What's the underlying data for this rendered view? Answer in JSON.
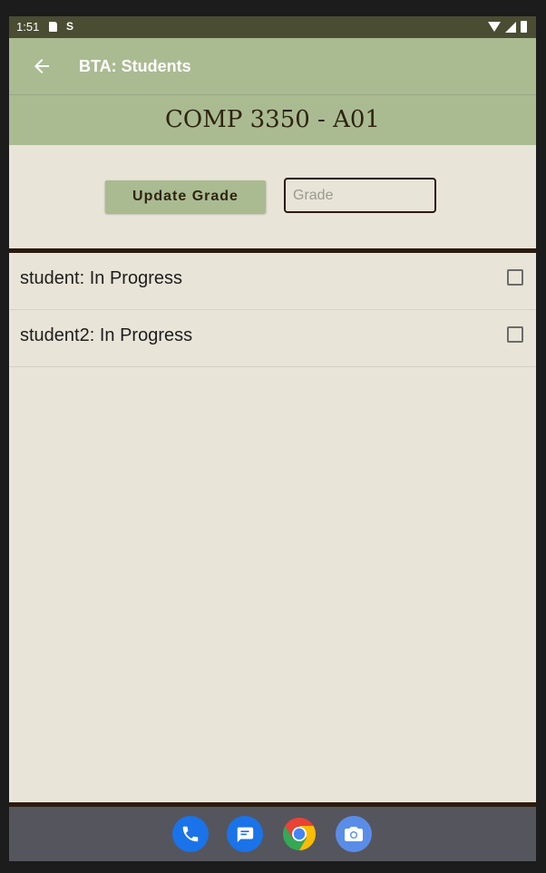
{
  "status_bar": {
    "time": "1:51",
    "notif_icons": [
      "sd-card-icon",
      "s-icon"
    ],
    "s_glyph": "S",
    "right_icons": [
      "wifi-icon",
      "signal-icon",
      "battery-icon"
    ]
  },
  "app_bar": {
    "back_icon": "arrow-back-icon",
    "title": "BTA: Students",
    "background": "#aabb92"
  },
  "course": {
    "title": "COMP 3350 - A01"
  },
  "grade_form": {
    "update_label": "Update Grade",
    "grade_value": "",
    "grade_placeholder": "Grade"
  },
  "students": [
    {
      "label": "student: In Progress",
      "checked": false
    },
    {
      "label": "student2: In Progress",
      "checked": false
    }
  ],
  "dock": {
    "apps": [
      "phone-icon",
      "messages-icon",
      "chrome-icon",
      "camera-icon"
    ]
  },
  "colors": {
    "accent": "#aabb92",
    "background": "#e8e4d7",
    "divider": "#2b1b0e",
    "status_bar": "#4a4d32",
    "nav_bar": "#55555d"
  }
}
